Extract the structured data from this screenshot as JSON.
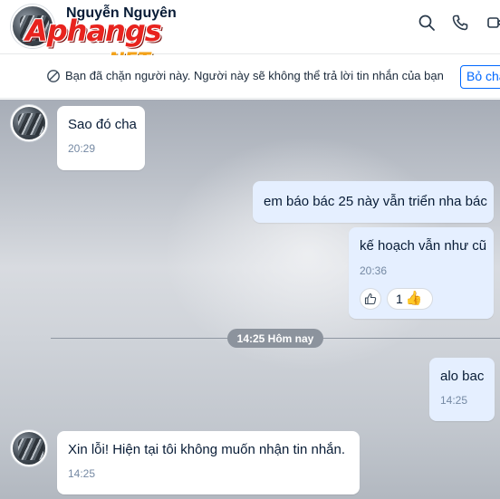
{
  "header": {
    "contact_name": "Nguyễn Nguyên",
    "watermark_main": "Aphangs",
    "watermark_sub": ".NET",
    "icons": [
      "search-icon",
      "phone-icon",
      "video-call-icon"
    ]
  },
  "banner": {
    "icon": "block-icon",
    "text": "Bạn đã chặn người này. Người này sẽ không thể trả lời tin nhắn của bạn",
    "unblock_label": "Bỏ chặn"
  },
  "messages": [
    {
      "sender": "contact",
      "text": "Sao đó cha",
      "time": "20:29"
    },
    {
      "sender": "me",
      "text": "em báo bác 25 này vẫn triển nha bác"
    },
    {
      "sender": "me",
      "text": "kế hoạch vẫn như cũ",
      "time": "20:36",
      "reactions": {
        "like_icon": "thumbs-up-outline-icon",
        "count": "1",
        "emoji": "👍"
      }
    },
    {
      "sender": "me",
      "text": "alo bac",
      "time": "14:25"
    },
    {
      "sender": "contact",
      "text": "Xin lỗi! Hiện tại tôi không muốn nhận tin nhắn.",
      "time": "14:25"
    }
  ],
  "date_separator": "14:25 Hôm nay",
  "colors": {
    "accent": "#0068ff",
    "my_bubble": "#e5efff",
    "their_bubble": "#ffffff",
    "watermark_red": "#e8231e",
    "watermark_orange": "#f3a21a"
  }
}
